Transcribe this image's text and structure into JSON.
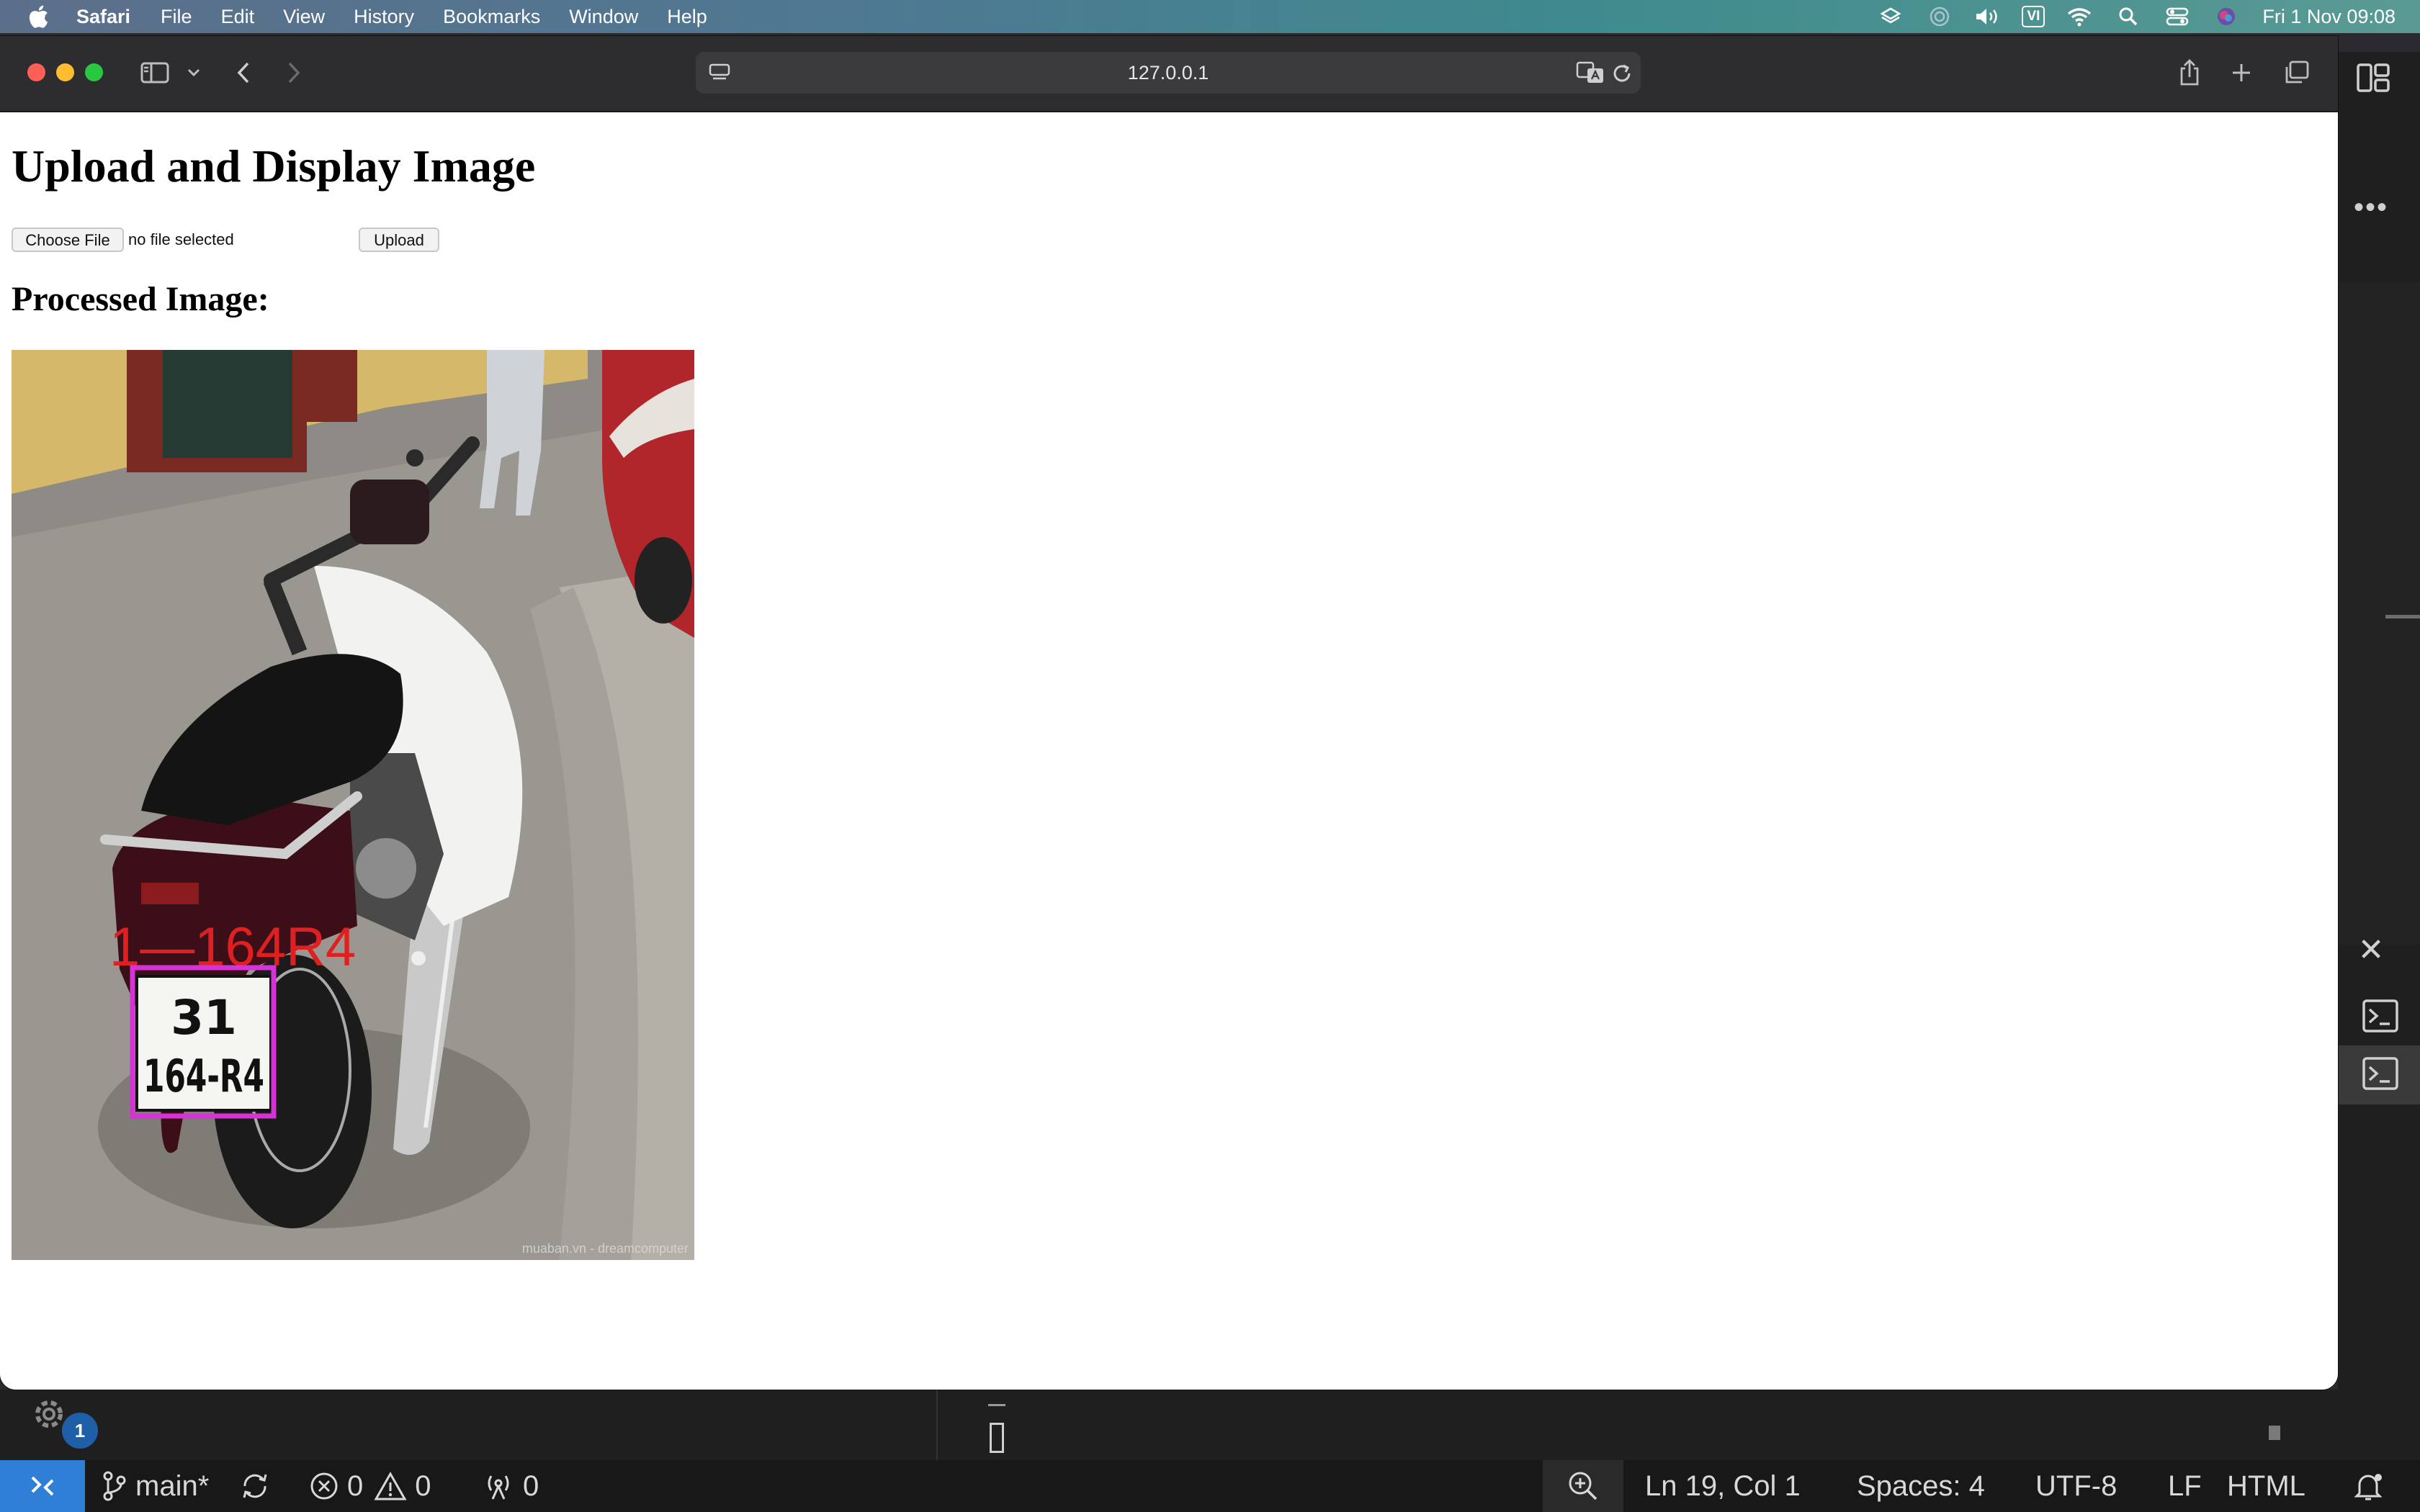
{
  "menubar": {
    "app_name": "Safari",
    "menus": [
      "File",
      "Edit",
      "View",
      "History",
      "Bookmarks",
      "Window",
      "Help"
    ],
    "input_source": "VI",
    "clock": "Fri 1 Nov  09:08"
  },
  "browser": {
    "url": "127.0.0.1"
  },
  "page": {
    "title": "Upload and Display Image",
    "choose_file_label": "Choose File",
    "file_status": "no file selected",
    "upload_label": "Upload",
    "result_heading": "Processed Image:",
    "image": {
      "detected_label": "1—164R4",
      "plate_line1": "31",
      "plate_line2": "164-R4",
      "watermark": "muaban.vn - dreamcomputer",
      "box_color": "#d633d6",
      "label_color": "#e02020"
    }
  },
  "editor": {
    "notification_count": "1",
    "branch": "main*",
    "errors": "0",
    "warnings": "0",
    "ports": "0",
    "cursor_position": "Ln 19, Col 1",
    "indentation": "Spaces: 4",
    "encoding": "UTF-8",
    "eol": "LF",
    "language": "HTML"
  }
}
